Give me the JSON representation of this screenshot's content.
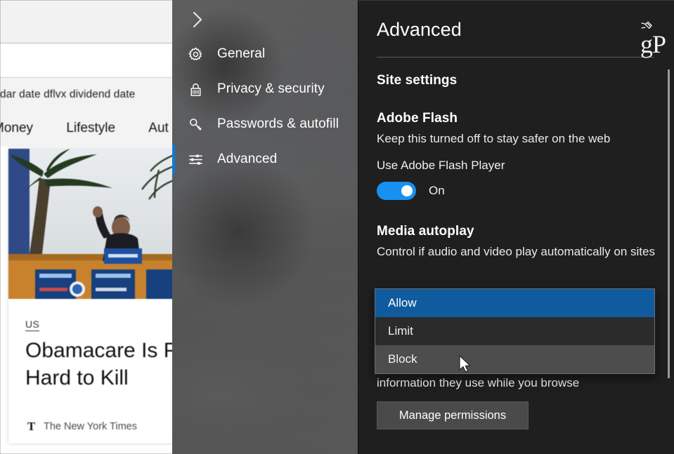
{
  "background_page": {
    "suggestion_text": "dar   date   dflvx dividend date",
    "nav_links": [
      "Money",
      "Lifestyle",
      "Aut"
    ],
    "news_card": {
      "kicker": "US",
      "headline_line1": "Obamacare Is Pr",
      "headline_line2": "Hard to Kill",
      "source": "The New York Times",
      "source_mark": "T"
    }
  },
  "settings_nav": {
    "back_icon": "chevron-right-icon",
    "items": [
      {
        "label": "General",
        "icon": "gear-icon",
        "selected": false
      },
      {
        "label": "Privacy & security",
        "icon": "lock-icon",
        "selected": false
      },
      {
        "label": "Passwords & autofill",
        "icon": "key-icon",
        "selected": false
      },
      {
        "label": "Advanced",
        "icon": "sliders-icon",
        "selected": true
      }
    ]
  },
  "detail": {
    "title": "Advanced",
    "watermark": "gP",
    "pin_icon": "pin-icon",
    "site_settings_heading": "Site settings",
    "flash": {
      "heading": "Adobe Flash",
      "description": "Keep this turned off to stay safer on the web",
      "toggle_label": "Use Adobe Flash Player",
      "toggle_state": "On",
      "toggle_on": true
    },
    "media_autoplay": {
      "heading": "Media autoplay",
      "description": "Control if audio and video play automatically on sites",
      "selected_value": "Allow",
      "hovered_value": "Block",
      "options": [
        "Allow",
        "Limit",
        "Block"
      ]
    },
    "permissions": {
      "description_visible": "information they use while you browse",
      "button_label": "Manage permissions"
    }
  },
  "colors": {
    "panel_background": "#1f1f1f",
    "accent_blue": "#0a7cd6",
    "toggle_blue": "#1890f1",
    "dropdown_selected": "#0f5b9e",
    "dropdown_hover": "#4d4d4d",
    "button_gray": "#4a4a4a",
    "sidebar_acrylic": "#5a5a5a"
  }
}
